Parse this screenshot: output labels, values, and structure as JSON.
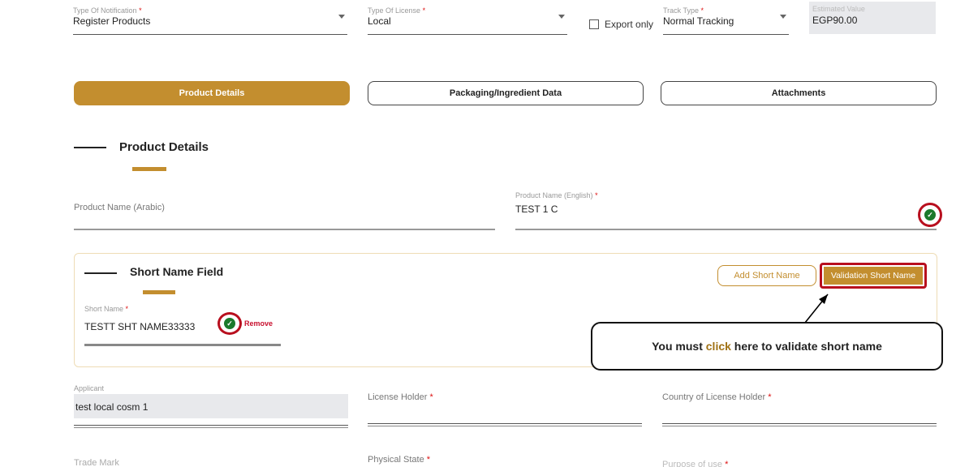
{
  "header": {
    "notification": {
      "label": "Type Of Notification",
      "value": "Register Products"
    },
    "license": {
      "label": "Type Of License",
      "value": "Local"
    },
    "export_only": "Export only",
    "track": {
      "label": "Track Type",
      "value": "Normal Tracking"
    },
    "estimated": {
      "label": "Estimated Value",
      "value": "EGP90.00"
    }
  },
  "tabs": [
    {
      "label": "Product Details",
      "active": true
    },
    {
      "label": "Packaging/Ingredient Data",
      "active": false
    },
    {
      "label": "Attachments",
      "active": false
    }
  ],
  "product_section": {
    "title": "Product Details",
    "arabic_label": "Product Name (Arabic)",
    "english_label": "Product Name (English)",
    "english_value": "TEST 1 C"
  },
  "short_name_section": {
    "title": "Short Name Field",
    "short_name_label": "Short Name",
    "short_name_value": "TESTT SHT NAME33333",
    "remove_label": "Remove",
    "add_button": "Add Short Name",
    "validate_button": "Validation Short Name"
  },
  "callout": {
    "prefix": "You must ",
    "highlight": "click",
    "suffix": " here to validate short name"
  },
  "applicant_row": {
    "applicant_label": "Applicant",
    "applicant_value": "test local cosm 1",
    "license_holder_label": "License Holder",
    "country_label": "Country of License Holder"
  },
  "bottom_row": {
    "trade_mark_label": "Trade Mark",
    "physical_state_label": "Physical State",
    "purpose_label": "Purpose of use"
  },
  "required_mark": "*",
  "colors": {
    "gold": "#c38e2f",
    "red_ring": "#b80f1e",
    "green_check": "#1b7a2c"
  }
}
